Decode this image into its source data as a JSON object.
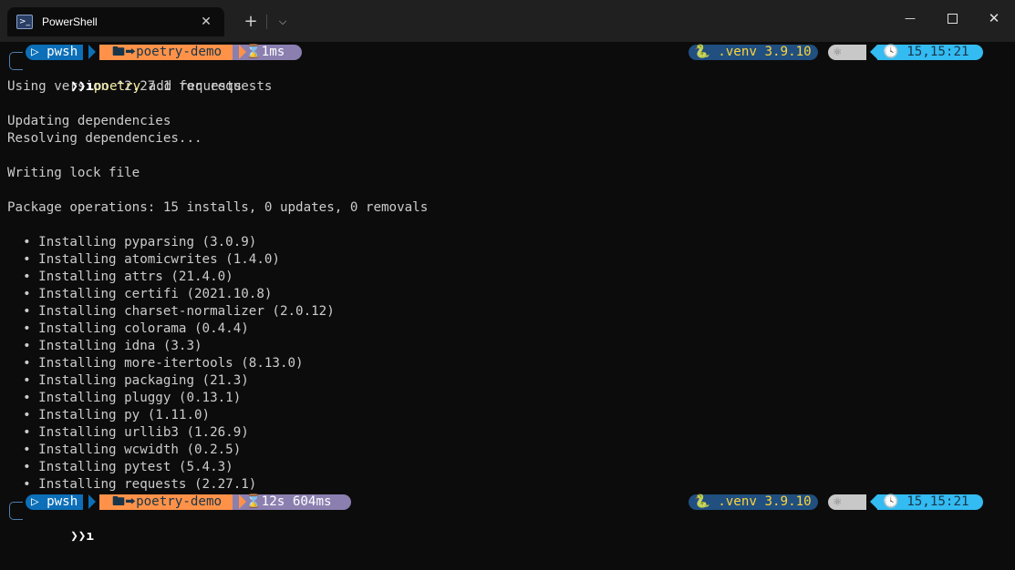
{
  "window": {
    "tab_title": "PowerShell",
    "tab_icon": "powershell-icon",
    "new_tab_label": "+",
    "dropdown_label": "⌵",
    "close_tab_label": "✕",
    "minimize_label": "—",
    "close_label": "✕"
  },
  "prompt1": {
    "shell": "▷ pwsh",
    "dir": "🖿⮕poetry-demo",
    "duration": "⌛1ms",
    "venv": "🐍 .venv 3.9.10",
    "node": "⚛",
    "clock": "🕓 15,15:21",
    "glyph": "❯❯ı",
    "command": "poetry",
    "args": " add requests"
  },
  "output": [
    "Using version ^2.27.1 for requests",
    "",
    "Updating dependencies",
    "Resolving dependencies...",
    "",
    "Writing lock file",
    "",
    "Package operations: 15 installs, 0 updates, 0 removals",
    "",
    "  • Installing pyparsing (3.0.9)",
    "  • Installing atomicwrites (1.4.0)",
    "  • Installing attrs (21.4.0)",
    "  • Installing certifi (2021.10.8)",
    "  • Installing charset-normalizer (2.0.12)",
    "  • Installing colorama (0.4.4)",
    "  • Installing idna (3.3)",
    "  • Installing more-itertools (8.13.0)",
    "  • Installing packaging (21.3)",
    "  • Installing pluggy (0.13.1)",
    "  • Installing py (1.11.0)",
    "  • Installing urllib3 (1.26.9)",
    "  • Installing wcwidth (0.2.5)",
    "  • Installing pytest (5.4.3)",
    "  • Installing requests (2.27.1)"
  ],
  "prompt2": {
    "shell": "▷ pwsh",
    "dir": "🖿⮕poetry-demo",
    "duration": "⌛12s 604ms",
    "venv": "🐍 .venv 3.9.10",
    "node": "⚛",
    "clock": "🕓 15,15:21",
    "glyph": "❯❯ı"
  },
  "colors": {
    "background": "#0c0c0c",
    "titlebar": "#202020",
    "shell_segment": "#0c6fb8",
    "dir_segment": "#ff9248",
    "time_segment": "#8b7fb0",
    "venv_segment": "#204f80",
    "clock_segment": "#33bbf2",
    "command": "#f9f1a5"
  }
}
